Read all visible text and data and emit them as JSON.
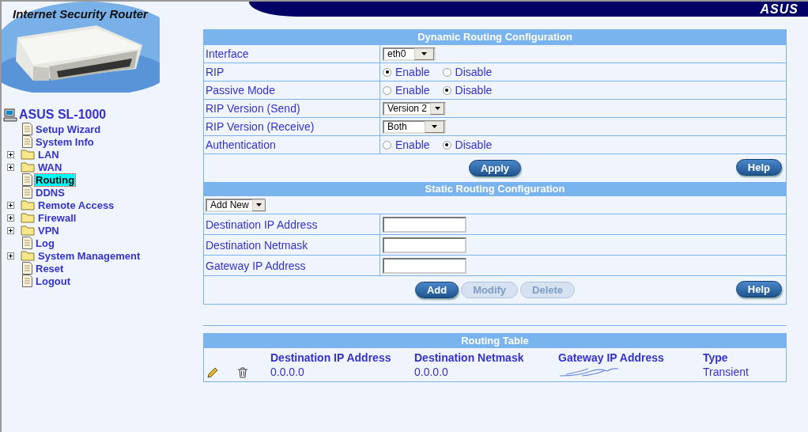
{
  "header": {
    "title": "Internet Security Router",
    "brand": "ASUS"
  },
  "sidebar": {
    "root": "ASUS SL-1000",
    "items": [
      {
        "label": "Setup Wizard",
        "kind": "page",
        "selected": false
      },
      {
        "label": "System Info",
        "kind": "page",
        "selected": false
      },
      {
        "label": "LAN",
        "kind": "folder",
        "expanded": false,
        "selected": false
      },
      {
        "label": "WAN",
        "kind": "folder",
        "expanded": false,
        "selected": false
      },
      {
        "label": "Routing",
        "kind": "page",
        "selected": true
      },
      {
        "label": "DDNS",
        "kind": "page",
        "selected": false
      },
      {
        "label": "Remote Access",
        "kind": "folder",
        "expanded": false,
        "selected": false
      },
      {
        "label": "Firewall",
        "kind": "folder",
        "expanded": false,
        "selected": false
      },
      {
        "label": "VPN",
        "kind": "folder",
        "expanded": false,
        "selected": false
      },
      {
        "label": "Log",
        "kind": "page",
        "selected": false
      },
      {
        "label": "System Management",
        "kind": "folder",
        "expanded": false,
        "selected": false
      },
      {
        "label": "Reset",
        "kind": "page",
        "selected": false
      },
      {
        "label": "Logout",
        "kind": "page",
        "selected": false
      }
    ]
  },
  "dynamic_routing": {
    "title": "Dynamic Routing Configuration",
    "rows": [
      {
        "label": "Interface",
        "kind": "select",
        "value": "eth0"
      },
      {
        "label": "RIP",
        "kind": "radio",
        "options": [
          {
            "label": "Enable",
            "selected": true
          },
          {
            "label": "Disable",
            "selected": false
          }
        ]
      },
      {
        "label": "Passive Mode",
        "kind": "radio",
        "options": [
          {
            "label": "Enable",
            "selected": false
          },
          {
            "label": "Disable",
            "selected": true
          }
        ]
      },
      {
        "label": "RIP Version (Send)",
        "kind": "select",
        "value": "Version 2"
      },
      {
        "label": "RIP Version (Receive)",
        "kind": "select",
        "value": "Both"
      },
      {
        "label": "Authentication",
        "kind": "radio",
        "options": [
          {
            "label": "Enable",
            "selected": false
          },
          {
            "label": "Disable",
            "selected": true
          }
        ]
      }
    ],
    "buttons": [
      {
        "label": "Apply",
        "disabled": false
      }
    ],
    "help": "Help"
  },
  "static_routing": {
    "title": "Static Routing Configuration",
    "mode": "Add New",
    "fields": [
      {
        "label": "Destination IP Address"
      },
      {
        "label": "Destination Netmask"
      },
      {
        "label": "Gateway IP Address"
      }
    ],
    "buttons": [
      {
        "label": "Add",
        "disabled": false
      },
      {
        "label": "Modify",
        "disabled": true
      },
      {
        "label": "Delete",
        "disabled": true
      }
    ],
    "help": "Help"
  },
  "routing_table": {
    "title": "Routing Table",
    "columns": [
      "Destination IP Address",
      "Destination Netmask",
      "Gateway IP Address",
      "Type"
    ],
    "rows": [
      {
        "destination": "0.0.0.0",
        "netmask": "0.0.0.0",
        "type": "Transient"
      }
    ]
  }
}
